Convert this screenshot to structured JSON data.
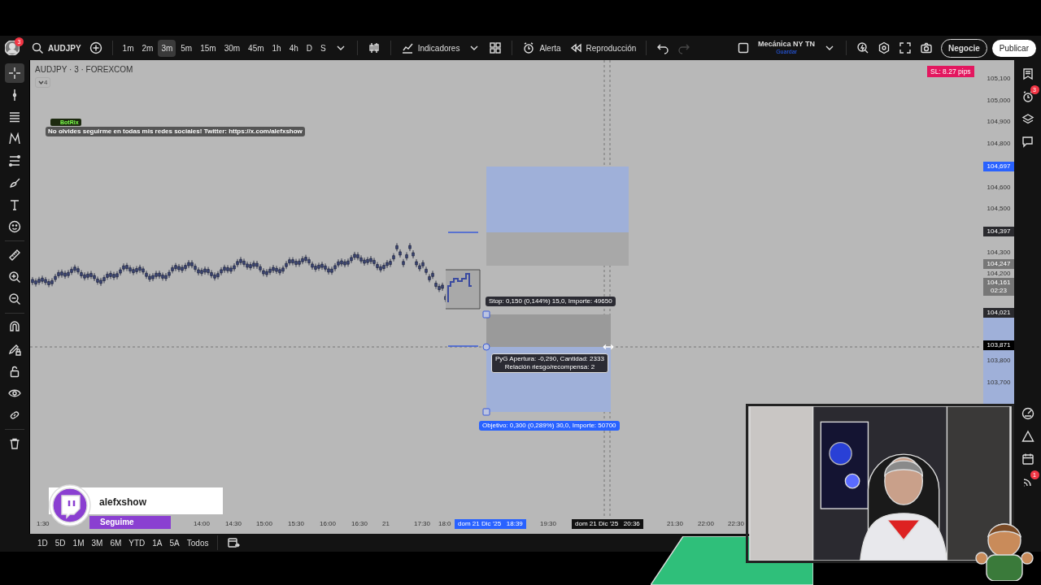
{
  "toolbar": {
    "avatar_badge": "3",
    "symbol": "AUDJPY",
    "intervals": [
      {
        "label": "1m",
        "selected": false
      },
      {
        "label": "2m",
        "selected": false
      },
      {
        "label": "3m",
        "selected": true
      },
      {
        "label": "5m",
        "selected": false
      },
      {
        "label": "15m",
        "selected": false
      },
      {
        "label": "30m",
        "selected": false
      },
      {
        "label": "45m",
        "selected": false
      },
      {
        "label": "1h",
        "selected": false
      },
      {
        "label": "4h",
        "selected": false
      },
      {
        "label": "D",
        "selected": false
      },
      {
        "label": "S",
        "selected": false
      }
    ],
    "indicators": "Indicadores",
    "alert": "Alerta",
    "replay": "Reproducción",
    "layout_name": "Mecánica NY TN",
    "layout_save": "Guardar",
    "trade": "Negocie",
    "publish": "Publicar"
  },
  "chart": {
    "title": "AUDJPY · 3 · FOREXCOM",
    "legend_toggle": "4",
    "bot": {
      "name": "BotRix",
      "message": "No olvides seguirme en todas mis redes sociales! Twitter: https://x.com/alefxshow"
    },
    "sl_badge": "SL: 8.27 pips",
    "price_labels": [
      {
        "text": "105,100",
        "kind": "plain"
      },
      {
        "text": "105,000",
        "kind": "plain"
      },
      {
        "text": "104,900",
        "kind": "plain"
      },
      {
        "text": "104,800",
        "kind": "plain"
      },
      {
        "text": "104,697",
        "kind": "blue"
      },
      {
        "text": "104,600",
        "kind": "plain"
      },
      {
        "text": "104,500",
        "kind": "plain"
      },
      {
        "text": "104,397",
        "kind": "dark"
      },
      {
        "text": "104,300",
        "kind": "plain"
      },
      {
        "text": "104,247",
        "kind": "gray"
      },
      {
        "text": "104,200",
        "kind": "plain"
      },
      {
        "text": "104,161",
        "sub": "02:23",
        "kind": "gray"
      },
      {
        "text": "104,021",
        "kind": "dark"
      },
      {
        "text": "103,871",
        "kind": "black"
      },
      {
        "text": "103,800",
        "kind": "plain"
      },
      {
        "text": "103,700",
        "kind": "plain"
      }
    ],
    "stop_label": "Stop: 0,150 (0,144%) 15,0, Importe: 49650",
    "pnl_lines": [
      "PyG Apertura: -0,290, Cantidad: 2333",
      "Relación riesgo/recompensa: 2"
    ],
    "target_label": "Objetivo: 0,300 (0,289%) 30,0, Importe: 50700",
    "time_labels": [
      {
        "text": "1:30",
        "kind": "plain"
      },
      {
        "text": "14:00",
        "kind": "plain"
      },
      {
        "text": "14:30",
        "kind": "plain"
      },
      {
        "text": "15:00",
        "kind": "plain"
      },
      {
        "text": "15:30",
        "kind": "plain"
      },
      {
        "text": "16:00",
        "kind": "plain"
      },
      {
        "text": "16:30",
        "kind": "plain"
      },
      {
        "text": "21",
        "kind": "plain"
      },
      {
        "text": "17:30",
        "kind": "plain"
      },
      {
        "text": "18:0",
        "kind": "plain"
      },
      {
        "text": "dom 21 Dic '25   18:39",
        "kind": "blue"
      },
      {
        "text": "19:30",
        "kind": "plain"
      },
      {
        "text": "dom 21 Dic '25   20:36",
        "kind": "dark"
      },
      {
        "text": "21:30",
        "kind": "plain"
      },
      {
        "text": "22:00",
        "kind": "plain"
      },
      {
        "text": "22:30",
        "kind": "plain"
      }
    ]
  },
  "ranges": [
    "1D",
    "5D",
    "1M",
    "3M",
    "6M",
    "YTD",
    "1A",
    "5A",
    "Todos"
  ],
  "right_bar": {
    "alerts_badge": "3",
    "notice_badge": "1"
  },
  "stream": {
    "channel": "alefxshow",
    "follow": "Seguime"
  }
}
